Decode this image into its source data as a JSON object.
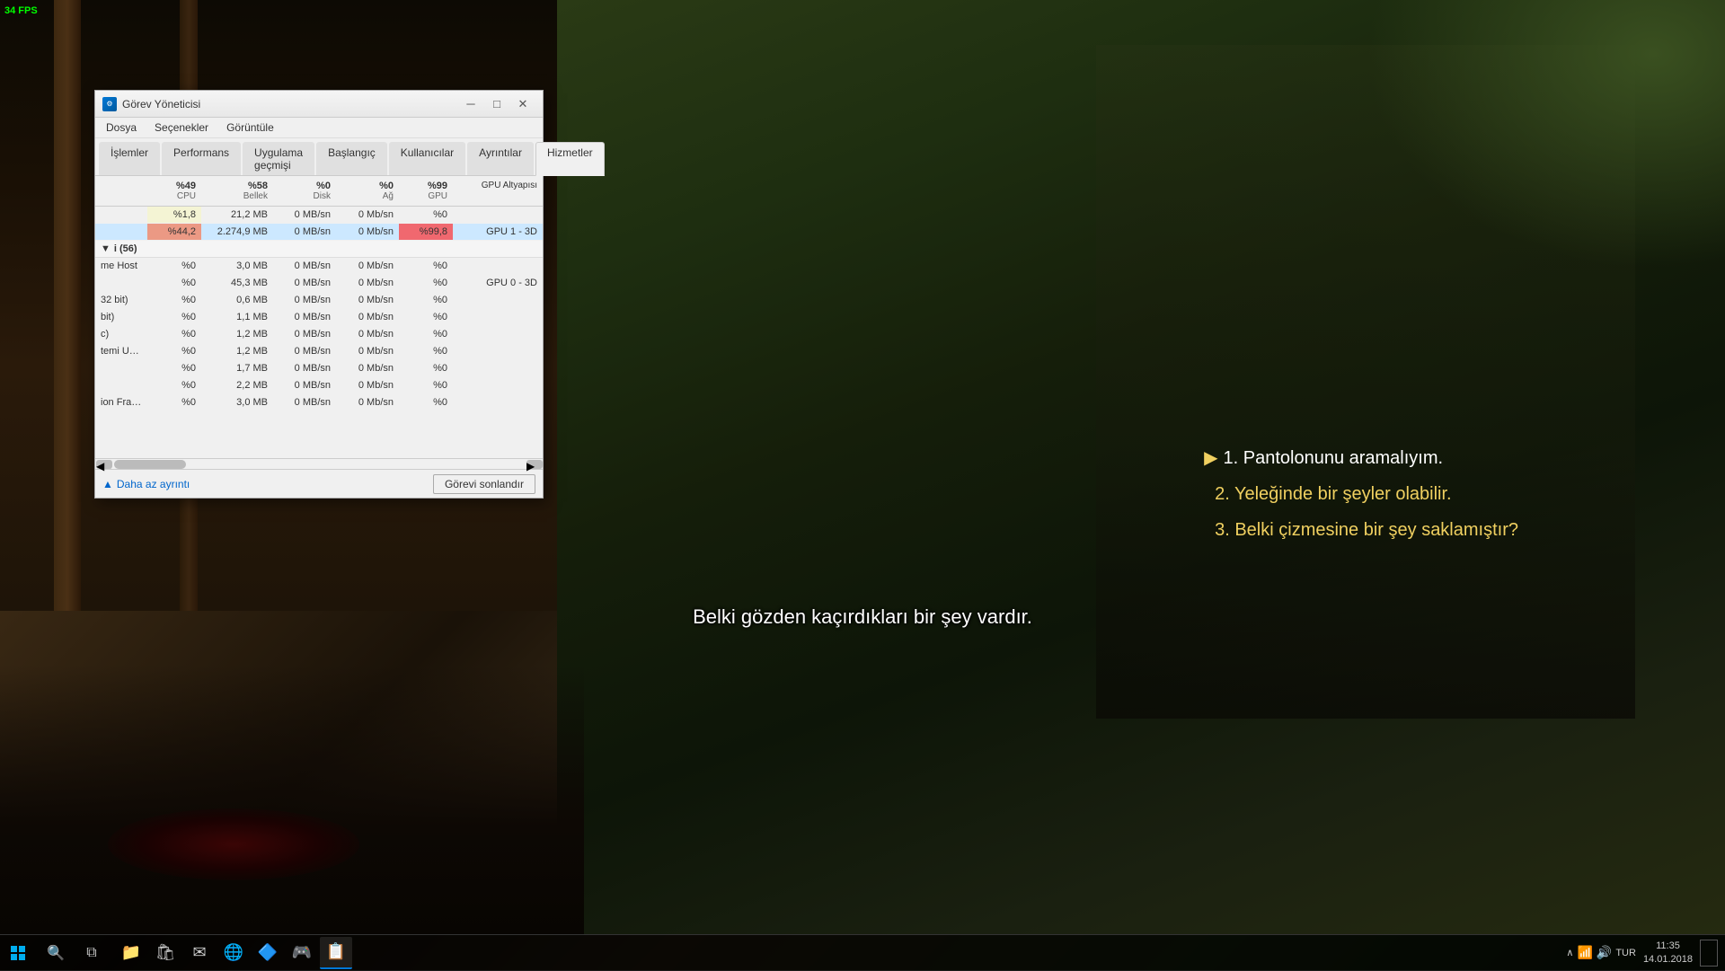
{
  "fps": {
    "label": "34 FPS"
  },
  "game": {
    "subtitle": "Belki gözden kaçırdıkları bir şey vardır.",
    "quest_option_1": "1. Pantolonunu aramalıyım.",
    "quest_option_2": "2. Yeleğinde bir şeyler olabilir.",
    "quest_option_3": "3. Belki çizmesine bir şey saklamıştır?"
  },
  "taskmgr": {
    "title": "Görev Yöneticisi",
    "menu": {
      "dosya": "Dosya",
      "secenekler": "Seçenekler",
      "goruntule": "Görüntüle"
    },
    "tabs": [
      {
        "label": "İşlemler",
        "active": false
      },
      {
        "label": "Performans",
        "active": false
      },
      {
        "label": "Uygulama geçmişi",
        "active": false
      },
      {
        "label": "Başlangıç",
        "active": false
      },
      {
        "label": "Kullanıcılar",
        "active": false
      },
      {
        "label": "Ayrıntılar",
        "active": false
      },
      {
        "label": "Hizmetler",
        "active": false
      }
    ],
    "columns": {
      "name": "",
      "cpu": "%49\nCPU",
      "memory": "%58\nBellek",
      "disk": "%0\nDisk",
      "network": "%0\nAğ",
      "gpu": "%99\nGPU",
      "gpu_engine": "GPU Altyapısı"
    },
    "rows": [
      {
        "name": "",
        "cpu": "%1,8",
        "memory": "21,2 MB",
        "disk": "0 MB/sn",
        "network": "0 Mb/sn",
        "gpu": "%0",
        "gpu_engine": "",
        "selected": false,
        "highlighted": false
      },
      {
        "name": "",
        "cpu": "%44,2",
        "memory": "2.274,9 MB",
        "disk": "0 MB/sn",
        "network": "0 Mb/sn",
        "gpu": "%99,8",
        "gpu_engine": "GPU 1 - 3D",
        "selected": true,
        "highlighted": false
      },
      {
        "name": "i (56)",
        "cpu": "",
        "memory": "",
        "disk": "",
        "network": "",
        "gpu": "",
        "gpu_engine": "",
        "is_group": true
      },
      {
        "name": "me Host",
        "cpu": "%0",
        "memory": "3,0 MB",
        "disk": "0 MB/sn",
        "network": "0 Mb/sn",
        "gpu": "%0",
        "gpu_engine": ""
      },
      {
        "name": "",
        "cpu": "%0",
        "memory": "45,3 MB",
        "disk": "0 MB/sn",
        "network": "0 Mb/sn",
        "gpu": "%0",
        "gpu_engine": "GPU 0 - 3D"
      },
      {
        "name": "32 bit)",
        "cpu": "%0",
        "memory": "0,6 MB",
        "disk": "0 MB/sn",
        "network": "0 Mb/sn",
        "gpu": "%0",
        "gpu_engine": ""
      },
      {
        "name": "bit)",
        "cpu": "%0",
        "memory": "1,1 MB",
        "disk": "0 MB/sn",
        "network": "0 Mb/sn",
        "gpu": "%0",
        "gpu_engine": ""
      },
      {
        "name": "c)",
        "cpu": "%0",
        "memory": "1,2 MB",
        "disk": "0 MB/sn",
        "network": "0 Mb/sn",
        "gpu": "%0",
        "gpu_engine": ""
      },
      {
        "name": "temi Uygulaması",
        "cpu": "%0",
        "memory": "1,2 MB",
        "disk": "0 MB/sn",
        "network": "0 Mb/sn",
        "gpu": "%0",
        "gpu_engine": ""
      },
      {
        "name": "",
        "cpu": "%0",
        "memory": "1,7 MB",
        "disk": "0 MB/sn",
        "network": "0 Mb/sn",
        "gpu": "%0",
        "gpu_engine": ""
      },
      {
        "name": "",
        "cpu": "%0",
        "memory": "2,2 MB",
        "disk": "0 MB/sn",
        "network": "0 Mb/sn",
        "gpu": "%0",
        "gpu_engine": ""
      },
      {
        "name": "ion Framework ...",
        "cpu": "%0",
        "memory": "3,0 MB",
        "disk": "0 MB/sn",
        "network": "0 Mb/sn",
        "gpu": "%0",
        "gpu_engine": ""
      }
    ],
    "buttons": {
      "less_detail": "Daha az ayrıntı",
      "end_task": "Görevi sonlandır"
    }
  },
  "taskbar": {
    "time": "11:35",
    "date": "14.01.2018",
    "lang": "TUR",
    "icons": [
      {
        "name": "start",
        "glyph": "⊞"
      },
      {
        "name": "search",
        "glyph": "🔍"
      },
      {
        "name": "taskview",
        "glyph": "⧉"
      },
      {
        "name": "explorer",
        "glyph": "📁"
      },
      {
        "name": "store",
        "glyph": "🛍"
      },
      {
        "name": "mail",
        "glyph": "✉"
      },
      {
        "name": "browser",
        "glyph": "🌐"
      },
      {
        "name": "app1",
        "glyph": "🔷"
      },
      {
        "name": "app2",
        "glyph": "🎮"
      },
      {
        "name": "app3",
        "glyph": "📋"
      }
    ],
    "sys_tray": {
      "chevron": "∧",
      "network": "📶",
      "volume": "🔊",
      "battery": ""
    }
  }
}
